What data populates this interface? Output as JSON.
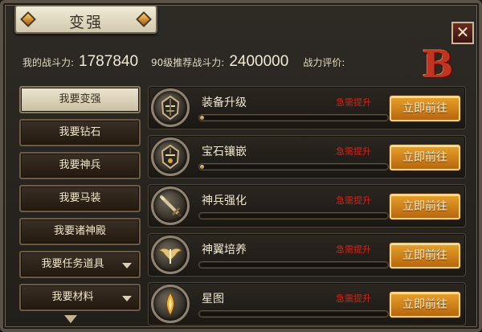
{
  "window": {
    "title": "变强",
    "close_glyph": "✕"
  },
  "stats": {
    "my_power_label": "我的战斗力:",
    "my_power_value": "1787840",
    "recommended_label": "90级推荐战斗力:",
    "recommended_value": "2400000",
    "rating_label": "战力评价:",
    "rating_grade": "B",
    "grade_color": "#c23420"
  },
  "sidebar": {
    "items": [
      {
        "label": "我要变强",
        "active": true,
        "has_dropdown": false
      },
      {
        "label": "我要钻石",
        "active": false,
        "has_dropdown": false
      },
      {
        "label": "我要神兵",
        "active": false,
        "has_dropdown": false
      },
      {
        "label": "我要马装",
        "active": false,
        "has_dropdown": false
      },
      {
        "label": "我要诸神殿",
        "active": false,
        "has_dropdown": false
      },
      {
        "label": "我要任务道具",
        "active": false,
        "has_dropdown": true
      },
      {
        "label": "我要材料",
        "active": false,
        "has_dropdown": true
      }
    ]
  },
  "rows": [
    {
      "title": "装备升级",
      "status": "急需提升",
      "button": "立即前往",
      "progress": 0.02,
      "icon": "helmet-icon"
    },
    {
      "title": "宝石镶嵌",
      "status": "急需提升",
      "button": "立即前往",
      "progress": 0.02,
      "icon": "helmet-gem-icon"
    },
    {
      "title": "神兵强化",
      "status": "急需提升",
      "button": "立即前往",
      "progress": 0.0,
      "icon": "sword-icon"
    },
    {
      "title": "神翼培养",
      "status": "急需提升",
      "button": "立即前往",
      "progress": 0.0,
      "icon": "wings-icon"
    },
    {
      "title": "星图",
      "status": "急需提升",
      "button": "立即前往",
      "progress": 0.0,
      "icon": "star-chart-icon"
    }
  ],
  "colors": {
    "accent_gold": "#e6a02a",
    "urgent_red": "#d2251a",
    "panel_dark": "#221f1b"
  }
}
